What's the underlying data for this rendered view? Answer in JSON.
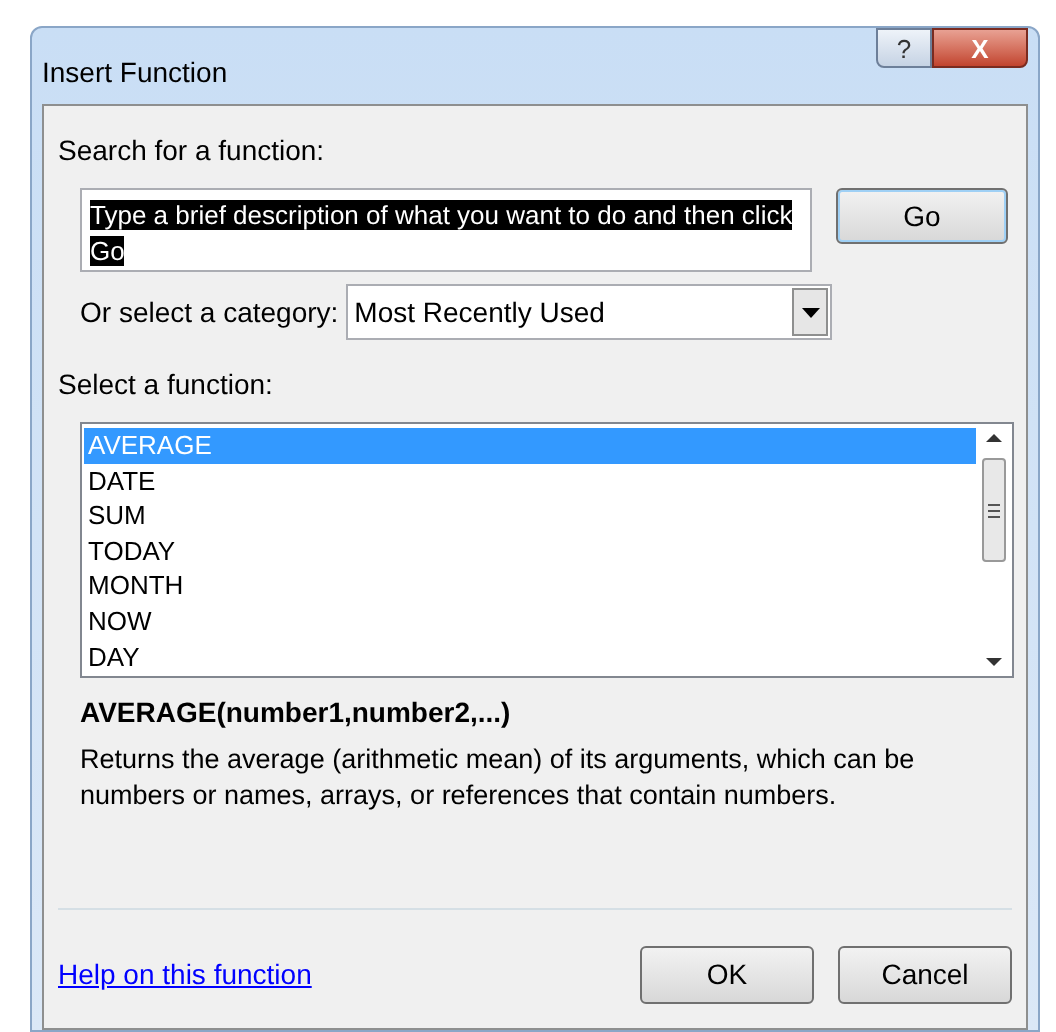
{
  "window": {
    "title": "Insert Function",
    "help_button": "?",
    "close_button": "X"
  },
  "search": {
    "label": "Search for a function:",
    "value": "Type a brief description of what you want to do and then click Go",
    "value_selected": true,
    "button": "Go"
  },
  "category": {
    "label": "Or select a category:",
    "value": "Most Recently Used"
  },
  "function_list": {
    "label": "Select a function:",
    "items": [
      {
        "name": "AVERAGE",
        "selected": true
      },
      {
        "name": "DATE",
        "selected": false
      },
      {
        "name": "SUM",
        "selected": false
      },
      {
        "name": "TODAY",
        "selected": false
      },
      {
        "name": "MONTH",
        "selected": false
      },
      {
        "name": "NOW",
        "selected": false
      },
      {
        "name": "DAY",
        "selected": false
      }
    ]
  },
  "syntax": "AVERAGE(number1,number2,...)",
  "description": "Returns the average (arithmetic mean) of its arguments, which can be numbers or names, arrays, or references that contain numbers.",
  "help_link": "Help on this function",
  "buttons": [
    "OK",
    "Cancel"
  ]
}
